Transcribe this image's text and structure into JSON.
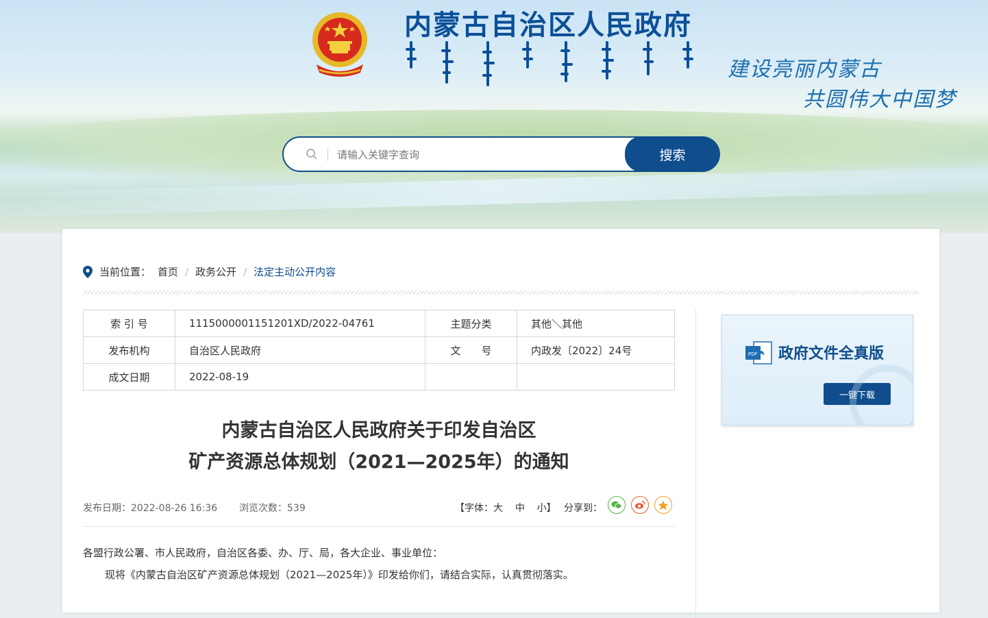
{
  "header": {
    "site_title": "内蒙古自治区人民政府",
    "slogan_line1": "建设亮丽内蒙古",
    "slogan_line2": "共圆伟大中国梦"
  },
  "search": {
    "placeholder": "请输入关键字查询",
    "button_label": "搜索"
  },
  "breadcrumb": {
    "prefix": "当前位置：",
    "items": [
      "首页",
      "政务公开",
      "法定主动公开内容"
    ]
  },
  "meta_table": {
    "rows": [
      [
        "索 引 号",
        "1115000001151201XD/2022-04761",
        "主题分类",
        "其他＼其他"
      ],
      [
        "发布机构",
        "自治区人民政府",
        "文　　号",
        "内政发〔2022〕24号"
      ],
      [
        "成文日期",
        "2022-08-19",
        "",
        ""
      ]
    ]
  },
  "article": {
    "title_line1": "内蒙古自治区人民政府关于印发自治区",
    "title_line2": "矿产资源总体规划（2021—2025年）的通知",
    "publish_date": "发布日期：2022-08-26 16:36",
    "views": "浏览次数：539",
    "font_size_label": "【字体：",
    "font_large": "大",
    "font_medium": "中",
    "font_small": "小",
    "font_close": "】",
    "share_label": "分享到：",
    "paragraph1": "各盟行政公署、市人民政府，自治区各委、办、厅、局，各大企业、事业单位：",
    "paragraph2": "现将《内蒙古自治区矿产资源总体规划（2021—2025年）》印发给你们，请结合实际，认真贯彻落实。"
  },
  "sidecard": {
    "title": "政府文件全真版",
    "download_label": "一键下载"
  },
  "colors": {
    "brand_blue": "#0f4d8c",
    "title_blue": "#0c4f98"
  }
}
